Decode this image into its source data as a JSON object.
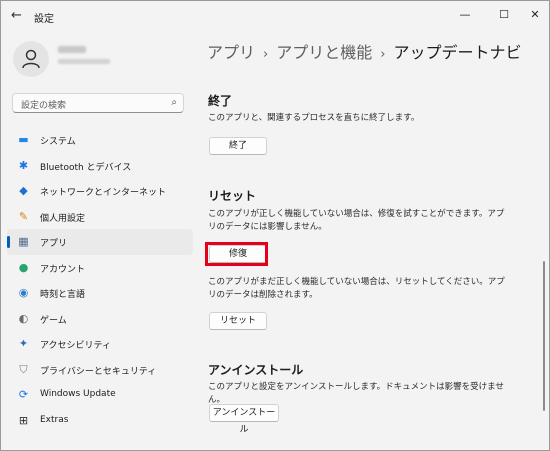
{
  "titlebar": {
    "back": "←",
    "title": "設定",
    "minimize": "—",
    "maximize": "☐",
    "close": "✕"
  },
  "search": {
    "placeholder": "設定の検索",
    "icon": "⌕"
  },
  "nav": [
    {
      "label": "システム",
      "icon": "system-icon",
      "glyph": "▬",
      "color": "#1e88e5"
    },
    {
      "label": "Bluetooth とデバイス",
      "icon": "bluetooth-icon",
      "glyph": "✱",
      "color": "#1a73e8"
    },
    {
      "label": "ネットワークとインターネット",
      "icon": "network-icon",
      "glyph": "◆",
      "color": "#1f6fd0"
    },
    {
      "label": "個人用設定",
      "icon": "brush-icon",
      "glyph": "✎",
      "color": "#e07b1a"
    },
    {
      "label": "アプリ",
      "icon": "apps-icon",
      "glyph": "▦",
      "color": "#4d6a8a"
    },
    {
      "label": "アカウント",
      "icon": "account-icon",
      "glyph": "●",
      "color": "#2aa373"
    },
    {
      "label": "時刻と言語",
      "icon": "globe-clock-icon",
      "glyph": "◉",
      "color": "#2d7fd3"
    },
    {
      "label": "ゲーム",
      "icon": "game-icon",
      "glyph": "◐",
      "color": "#6b6b6b"
    },
    {
      "label": "アクセシビリティ",
      "icon": "accessibility-icon",
      "glyph": "✦",
      "color": "#2a6fb5"
    },
    {
      "label": "プライバシーとセキュリティ",
      "icon": "shield-icon",
      "glyph": "⛉",
      "color": "#7a7a7a"
    },
    {
      "label": "Windows Update",
      "icon": "update-icon",
      "glyph": "⟳",
      "color": "#1a73e8"
    },
    {
      "label": "Extras",
      "icon": "extras-icon",
      "glyph": "⊞",
      "color": "#333333"
    }
  ],
  "active_index": 4,
  "accent_color": "#005fb8",
  "highlight_color": "#e5001c",
  "breadcrumb": {
    "part1": "アプリ",
    "part2": "アプリと機能",
    "current": "アップデートナビ",
    "sep": "›"
  },
  "terminate": {
    "title": "終了",
    "desc": "このアプリと、関連するプロセスを直ちに終了します。",
    "button": "終了"
  },
  "reset": {
    "title": "リセット",
    "repair_desc": "このアプリが正しく機能していない場合は、修復を試すことができます。アプリのデータには影響しません。",
    "repair_button": "修復",
    "reset_desc": "このアプリがまだ正しく機能していない場合は、リセットしてください。アプリのデータは削除されます。",
    "reset_button": "リセット"
  },
  "uninstall": {
    "title": "アンインストール",
    "desc": "このアプリと設定をアンインストールします。ドキュメントは影響を受けません。",
    "button": "アンインストール"
  }
}
